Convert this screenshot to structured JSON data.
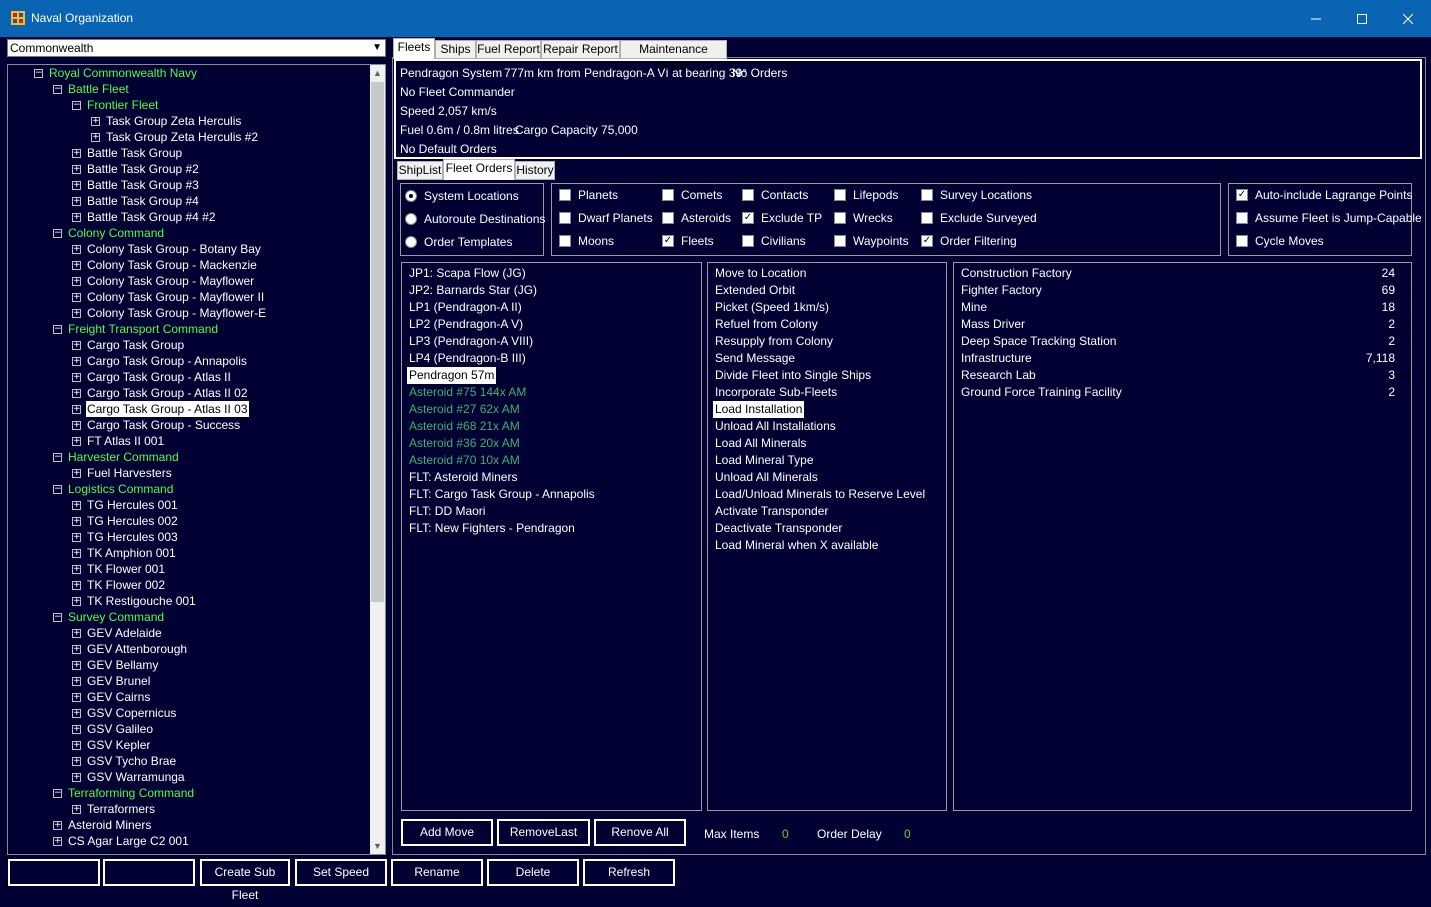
{
  "window": {
    "title": "Naval Organization"
  },
  "left": {
    "race_select": "Commonwealth",
    "tree": [
      {
        "label": "Royal Commonwealth Navy",
        "level": 0,
        "color": "green",
        "exp": "-"
      },
      {
        "label": "Battle Fleet",
        "level": 1,
        "color": "green",
        "exp": "-"
      },
      {
        "label": "Frontier Fleet",
        "level": 2,
        "color": "green",
        "exp": "-"
      },
      {
        "label": "Task Group Zeta Herculis",
        "level": 3,
        "color": "white",
        "exp": "+"
      },
      {
        "label": "Task Group Zeta Herculis #2",
        "level": 3,
        "color": "white",
        "exp": "+"
      },
      {
        "label": "Battle Task Group",
        "level": 2,
        "color": "white",
        "exp": "+"
      },
      {
        "label": "Battle Task Group #2",
        "level": 2,
        "color": "white",
        "exp": "+"
      },
      {
        "label": "Battle Task Group #3",
        "level": 2,
        "color": "white",
        "exp": "+"
      },
      {
        "label": "Battle Task Group #4",
        "level": 2,
        "color": "white",
        "exp": "+"
      },
      {
        "label": "Battle Task Group #4 #2",
        "level": 2,
        "color": "white",
        "exp": "+"
      },
      {
        "label": "Colony Command",
        "level": 1,
        "color": "green",
        "exp": "-"
      },
      {
        "label": "Colony Task Group - Botany Bay",
        "level": 2,
        "color": "white",
        "exp": "+"
      },
      {
        "label": "Colony Task Group - Mackenzie",
        "level": 2,
        "color": "white",
        "exp": "+"
      },
      {
        "label": "Colony Task Group - Mayflower",
        "level": 2,
        "color": "white",
        "exp": "+"
      },
      {
        "label": "Colony Task Group - Mayflower II",
        "level": 2,
        "color": "white",
        "exp": "+"
      },
      {
        "label": "Colony Task Group - Mayflower-E",
        "level": 2,
        "color": "white",
        "exp": "+"
      },
      {
        "label": "Freight Transport Command",
        "level": 1,
        "color": "green",
        "exp": "-"
      },
      {
        "label": "Cargo Task Group",
        "level": 2,
        "color": "white",
        "exp": "+"
      },
      {
        "label": "Cargo Task Group - Annapolis",
        "level": 2,
        "color": "white",
        "exp": "+"
      },
      {
        "label": "Cargo Task Group - Atlas II",
        "level": 2,
        "color": "white",
        "exp": "+"
      },
      {
        "label": "Cargo Task Group - Atlas II 02",
        "level": 2,
        "color": "white",
        "exp": "+"
      },
      {
        "label": "Cargo Task Group - Atlas II 03",
        "level": 2,
        "color": "white",
        "exp": "+",
        "selected": true
      },
      {
        "label": "Cargo Task Group - Success",
        "level": 2,
        "color": "white",
        "exp": "+"
      },
      {
        "label": "FT Atlas II 001",
        "level": 2,
        "color": "white",
        "exp": "+"
      },
      {
        "label": "Harvester Command",
        "level": 1,
        "color": "green",
        "exp": "-"
      },
      {
        "label": "Fuel Harvesters",
        "level": 2,
        "color": "white",
        "exp": "+"
      },
      {
        "label": "Logistics Command",
        "level": 1,
        "color": "green",
        "exp": "-"
      },
      {
        "label": "TG Hercules 001",
        "level": 2,
        "color": "white",
        "exp": "+"
      },
      {
        "label": "TG Hercules 002",
        "level": 2,
        "color": "white",
        "exp": "+"
      },
      {
        "label": "TG Hercules 003",
        "level": 2,
        "color": "white",
        "exp": "+"
      },
      {
        "label": "TK Amphion 001",
        "level": 2,
        "color": "white",
        "exp": "+"
      },
      {
        "label": "TK Flower 001",
        "level": 2,
        "color": "white",
        "exp": "+"
      },
      {
        "label": "TK Flower 002",
        "level": 2,
        "color": "white",
        "exp": "+"
      },
      {
        "label": "TK Restigouche 001",
        "level": 2,
        "color": "white",
        "exp": "+"
      },
      {
        "label": "Survey Command",
        "level": 1,
        "color": "green",
        "exp": "-"
      },
      {
        "label": "GEV Adelaide",
        "level": 2,
        "color": "white",
        "exp": "+"
      },
      {
        "label": "GEV Attenborough",
        "level": 2,
        "color": "white",
        "exp": "+"
      },
      {
        "label": "GEV Bellamy",
        "level": 2,
        "color": "white",
        "exp": "+"
      },
      {
        "label": "GEV Brunel",
        "level": 2,
        "color": "white",
        "exp": "+"
      },
      {
        "label": "GEV Cairns",
        "level": 2,
        "color": "white",
        "exp": "+"
      },
      {
        "label": "GSV Copernicus",
        "level": 2,
        "color": "white",
        "exp": "+"
      },
      {
        "label": "GSV Galileo",
        "level": 2,
        "color": "white",
        "exp": "+"
      },
      {
        "label": "GSV Kepler",
        "level": 2,
        "color": "white",
        "exp": "+"
      },
      {
        "label": "GSV Tycho Brae",
        "level": 2,
        "color": "white",
        "exp": "+"
      },
      {
        "label": "GSV Warramunga",
        "level": 2,
        "color": "white",
        "exp": "+"
      },
      {
        "label": "Terraforming Command",
        "level": 1,
        "color": "green",
        "exp": "-"
      },
      {
        "label": "Terraformers",
        "level": 2,
        "color": "white",
        "exp": "+"
      },
      {
        "label": "Asteroid Miners",
        "level": 1,
        "color": "white",
        "exp": "+"
      },
      {
        "label": "CS Agar Large C2 001",
        "level": 1,
        "color": "white",
        "exp": "+"
      }
    ]
  },
  "bottom_buttons": [
    {
      "label": "",
      "dim": true
    },
    {
      "label": "",
      "dim": true
    },
    {
      "label": "Create Sub Fleet"
    },
    {
      "label": "Set Speed"
    },
    {
      "label": "Rename"
    },
    {
      "label": "Delete"
    },
    {
      "label": "Refresh"
    }
  ],
  "main_tabs": [
    {
      "label": "Fleets",
      "active": true
    },
    {
      "label": "Ships"
    },
    {
      "label": "Fuel Report"
    },
    {
      "label": "Repair Report"
    },
    {
      "label": "Maintenance Report"
    }
  ],
  "info": {
    "system": "Pendragon System",
    "distance": "777m km from Pendragon-A VI at bearing 39°",
    "orders": "No Orders",
    "commander": "No Fleet Commander",
    "speed": "Speed 2,057 km/s",
    "fuel": "Fuel 0.6m / 0.8m litres",
    "cargo": "Cargo Capacity 75,000",
    "default_orders": "No Default Orders"
  },
  "sub_tabs": [
    {
      "label": "ShipList"
    },
    {
      "label": "Fleet Orders",
      "active": true
    },
    {
      "label": "History"
    }
  ],
  "radio_options": [
    {
      "label": "System Locations",
      "on": true
    },
    {
      "label": "Autoroute Destinations",
      "on": false
    },
    {
      "label": "Order Templates",
      "on": false
    }
  ],
  "filter_checks": [
    [
      {
        "label": "Planets",
        "on": false
      },
      {
        "label": "Dwarf Planets",
        "on": false
      },
      {
        "label": "Moons",
        "on": false
      }
    ],
    [
      {
        "label": "Comets",
        "on": false
      },
      {
        "label": "Asteroids",
        "on": false
      },
      {
        "label": "Fleets",
        "on": true
      }
    ],
    [
      {
        "label": "Contacts",
        "on": false
      },
      {
        "label": "Exclude TP",
        "on": true
      },
      {
        "label": "Civilians",
        "on": false
      }
    ],
    [
      {
        "label": "Lifepods",
        "on": false
      },
      {
        "label": "Wrecks",
        "on": false
      },
      {
        "label": "Waypoints",
        "on": false
      }
    ],
    [
      {
        "label": "Survey Locations",
        "on": false
      },
      {
        "label": "Exclude Surveyed",
        "on": false
      },
      {
        "label": "Order Filtering",
        "on": true
      }
    ]
  ],
  "right_checks": [
    {
      "label": "Auto-include Lagrange Points",
      "on": true
    },
    {
      "label": "Assume Fleet is Jump-Capable",
      "on": false
    },
    {
      "label": "Cycle Moves",
      "on": false
    }
  ],
  "locations": [
    {
      "label": "JP1: Scapa Flow (JG)"
    },
    {
      "label": "JP2: Barnards Star (JG)"
    },
    {
      "label": "LP1  (Pendragon-A II)"
    },
    {
      "label": "LP2  (Pendragon-A V)"
    },
    {
      "label": "LP3  (Pendragon-A VIII)"
    },
    {
      "label": "LP4  (Pendragon-B III)"
    },
    {
      "label": "Pendragon  57m",
      "selected": true
    },
    {
      "label": "Asteroid #75  144x AM",
      "green": true
    },
    {
      "label": "Asteroid #27  62x AM",
      "green": true
    },
    {
      "label": "Asteroid #68  21x AM",
      "green": true
    },
    {
      "label": "Asteroid #36  20x AM",
      "green": true
    },
    {
      "label": "Asteroid #70  10x AM",
      "green": true
    },
    {
      "label": "FLT: Asteroid Miners"
    },
    {
      "label": "FLT: Cargo Task Group - Annapolis"
    },
    {
      "label": "FLT: DD Maori"
    },
    {
      "label": "FLT: New Fighters - Pendragon"
    }
  ],
  "actions": [
    {
      "label": "Move to Location"
    },
    {
      "label": "Extended Orbit"
    },
    {
      "label": "Picket (Speed 1km/s)"
    },
    {
      "label": "Refuel from Colony"
    },
    {
      "label": "Resupply from Colony"
    },
    {
      "label": "Send Message"
    },
    {
      "label": "Divide Fleet into Single Ships"
    },
    {
      "label": "Incorporate Sub-Fleets"
    },
    {
      "label": "Load Installation",
      "selected": true
    },
    {
      "label": "Unload All Installations"
    },
    {
      "label": "Load All Minerals"
    },
    {
      "label": "Load Mineral Type"
    },
    {
      "label": "Unload All Minerals"
    },
    {
      "label": "Load/Unload Minerals to Reserve Level"
    },
    {
      "label": "Activate Transponder"
    },
    {
      "label": "Deactivate Transponder"
    },
    {
      "label": "Load Mineral when X available"
    }
  ],
  "installations": [
    {
      "name": "Construction Factory",
      "qty": "24"
    },
    {
      "name": "Fighter Factory",
      "qty": "69"
    },
    {
      "name": "Mine",
      "qty": "18"
    },
    {
      "name": "Mass Driver",
      "qty": "2"
    },
    {
      "name": "Deep Space Tracking Station",
      "qty": "2"
    },
    {
      "name": "Infrastructure",
      "qty": "7,118"
    },
    {
      "name": "Research Lab",
      "qty": "3"
    },
    {
      "name": "Ground Force Training Facility",
      "qty": "2"
    }
  ],
  "order_buttons": [
    {
      "label": "Add Move"
    },
    {
      "label": "RemoveLast"
    },
    {
      "label": "Renove All"
    }
  ],
  "order_stats": {
    "max_items_label": "Max Items",
    "max_items": "0",
    "order_delay_label": "Order Delay",
    "order_delay": "0"
  },
  "colors": {
    "background": "#000033",
    "titlebar": "#0a64b4",
    "tree_green": "#4cff4c",
    "asteroid_green": "#3cb371",
    "stat_green": "#44dd44"
  }
}
